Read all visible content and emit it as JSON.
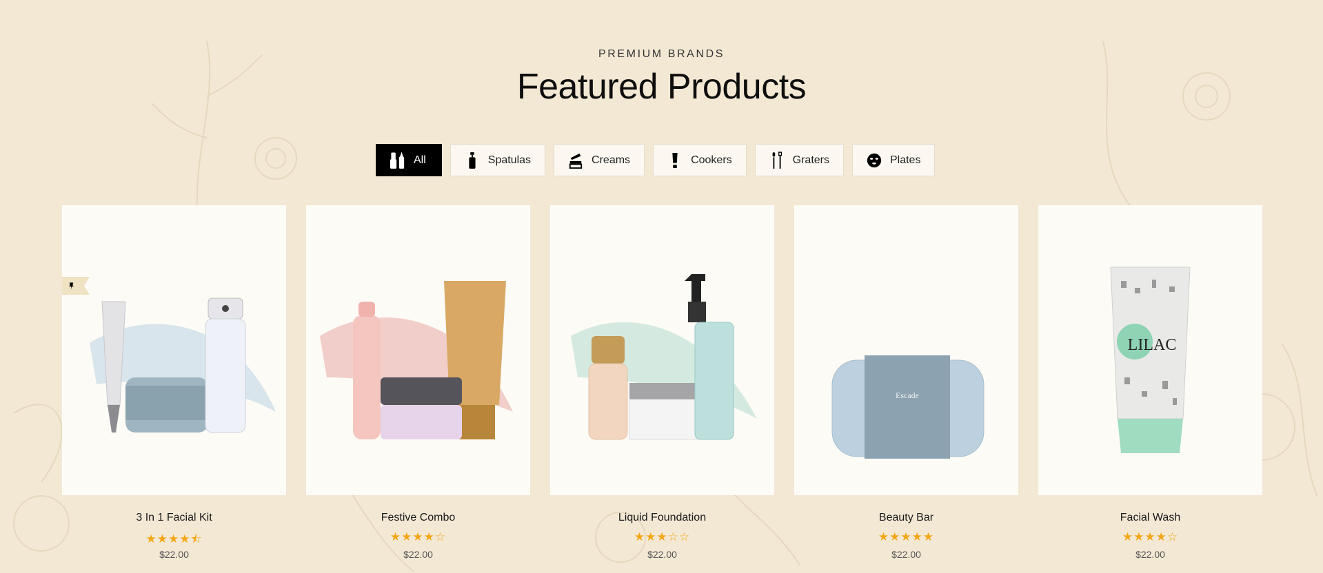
{
  "section": {
    "eyebrow": "PREMIUM BRANDS",
    "title": "Featured Products"
  },
  "tabs": [
    {
      "label": "All",
      "icon": "makeup-tools-icon",
      "active": true
    },
    {
      "label": "Spatulas",
      "icon": "pump-bottle-icon",
      "active": false
    },
    {
      "label": "Creams",
      "icon": "cream-jar-icon",
      "active": false
    },
    {
      "label": "Cookers",
      "icon": "lipstick-icon",
      "active": false
    },
    {
      "label": "Graters",
      "icon": "brush-icon",
      "active": false
    },
    {
      "label": "Plates",
      "icon": "face-mask-icon",
      "active": false
    }
  ],
  "products": [
    {
      "name": "3 In 1 Facial Kit",
      "rating": 4.5,
      "stars": "★★★★⯪",
      "price": "$22.00",
      "badge": "pin-icon"
    },
    {
      "name": "Festive Combo",
      "rating": 4,
      "stars": "★★★★☆",
      "price": "$22.00"
    },
    {
      "name": "Liquid Foundation",
      "rating": 3,
      "stars": "★★★☆☆",
      "price": "$22.00"
    },
    {
      "name": "Beauty Bar",
      "rating": 5,
      "stars": "★★★★★",
      "price": "$22.00"
    },
    {
      "name": "Facial Wash",
      "rating": 4,
      "stars": "★★★★☆",
      "price": "$22.00"
    }
  ],
  "colors": {
    "background": "#f3e8d4",
    "card": "#fdfbf6",
    "star": "#f3a613",
    "active_tab": "#000000"
  }
}
